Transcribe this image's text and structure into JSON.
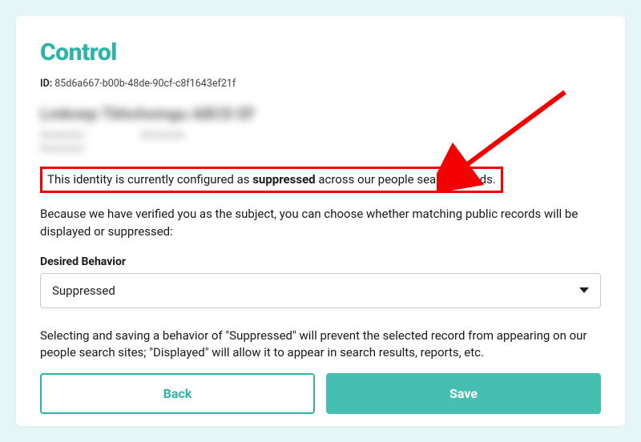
{
  "title": "Control",
  "id_label": "ID:",
  "id_value": "85d6a667-b00b-48de-90cf-c8f1643ef21f",
  "status_prefix": "This identity is currently configured as ",
  "status_bold": "suppressed",
  "status_suffix": " across our people search brands.",
  "verification_text": "Because we have verified you as the subject, you can choose whether matching public records will be displayed or suppressed:",
  "field_label": "Desired Behavior",
  "selected_value": "Suppressed",
  "helper_text": "Selecting and saving a behavior of \"Suppressed\" will prevent the selected record from appearing on our people search sites; \"Displayed\" will allow it to appear in search results, reports, etc.",
  "buttons": {
    "back": "Back",
    "save": "Save"
  }
}
